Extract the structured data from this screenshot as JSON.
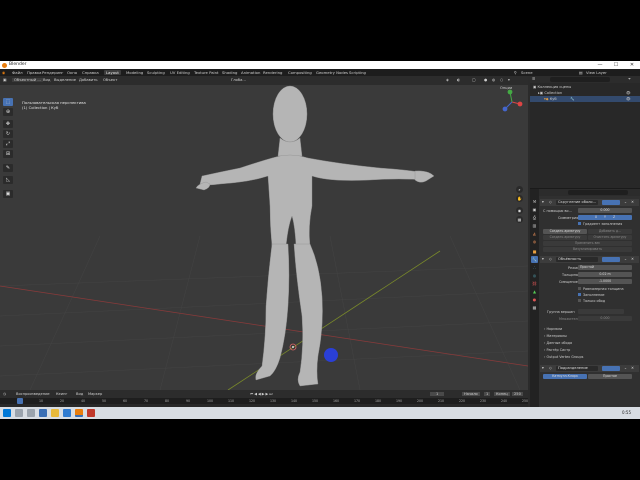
{
  "window": {
    "title": "Blender",
    "minimize": "—",
    "maximize": "☐",
    "close": "✕"
  },
  "menu": {
    "items": [
      "Файл",
      "Правка",
      "Рендеринг",
      "Окно",
      "Справка"
    ],
    "tabs": [
      "Layout",
      "Modeling",
      "Sculpting",
      "UV Editing",
      "Texture Paint",
      "Shading",
      "Animation",
      "Rendering",
      "Compositing",
      "Geometry Nodes",
      "Scripting"
    ],
    "active_tab": "Layout",
    "scene": "Scene",
    "view_layer": "View Layer"
  },
  "viewport": {
    "mode": "Объектный ...",
    "menus": [
      "Вид",
      "Выделение",
      "Добавить",
      "Объект"
    ],
    "transform": "Глоба...",
    "info_line1": "Пользовательская перспектива",
    "info_line2": "(1) Collection | Куб",
    "options": "Опции"
  },
  "toolbar": {
    "tools": [
      "select-tool",
      "cursor-tool",
      "move-tool",
      "rotate-tool",
      "scale-tool",
      "transform-tool",
      "annotate-tool",
      "measure-tool",
      "add-cube-tool"
    ]
  },
  "outliner": {
    "rows": [
      {
        "label": "Коллекция сцены",
        "indent": 0
      },
      {
        "label": "Collection",
        "indent": 1
      },
      {
        "label": "Куб",
        "indent": 2
      }
    ]
  },
  "properties": {
    "modifier_name": "Скругление оболо...",
    "modifier_rows": [
      {
        "label": "С помощью во...",
        "value": "0.000"
      },
      {
        "label": "Симметрия",
        "value": "X  Y  Z"
      }
    ],
    "gradient_label": "Градиент заполнения",
    "buttons": [
      "Создать арматуру",
      "Добавить д...",
      "Создать арматуру",
      "Очистить арматуру",
      "Применить вес",
      "Визуализировать"
    ],
    "panel2_title": "Объёмность",
    "panel2_rows": [
      {
        "label": "Режим",
        "value": "Простой"
      },
      {
        "label": "Толщина",
        "value": "0.02 m"
      },
      {
        "label": "Смещение",
        "value": "-1.0000"
      }
    ],
    "checks": [
      "Равномерная толщина",
      "Заполнение",
      "Только обод"
    ],
    "vertex_group_label": "Группа вершин",
    "factor_label": "Множитель",
    "factor_value": "0.000",
    "collapsed": [
      "Нормали",
      "Материалы",
      "Данные обода",
      "Растёр Cистр",
      "Output Vertex Groups"
    ],
    "panel3_title": "Подразделение",
    "bottom_buttons": [
      "Катмулл-Кларк",
      "Простое"
    ]
  },
  "timeline": {
    "menus": [
      "Воспроизведение",
      "Кеинг",
      "Вид",
      "Маркер"
    ],
    "current_frame": "1",
    "start_label": "Начало",
    "start": "1",
    "end_label": "Конец",
    "end": "250",
    "ticks": [
      "0",
      "10",
      "20",
      "40",
      "50",
      "60",
      "70",
      "80",
      "90",
      "100",
      "110",
      "120",
      "130",
      "140",
      "150",
      "160",
      "170",
      "180",
      "190",
      "200",
      "210",
      "220",
      "230",
      "240",
      "250"
    ]
  },
  "taskbar": {
    "time": "0:55"
  },
  "colors": {
    "accent": "#4772b3",
    "blender_orange": "#e87d0d",
    "viewport_bg": "#3a3a3a",
    "cursor": "#2a3fd6"
  }
}
